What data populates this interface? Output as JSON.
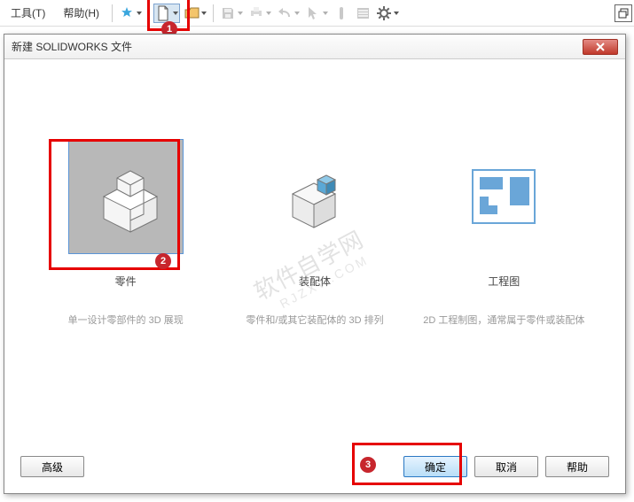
{
  "menu": {
    "tools": "工具(T)",
    "help": "帮助(H)"
  },
  "dialog": {
    "title": "新建 SOLIDWORKS 文件"
  },
  "options": [
    {
      "title": "零件",
      "desc": "单一设计零部件的 3D 展现"
    },
    {
      "title": "装配体",
      "desc": "零件和/或其它装配体的 3D 排列"
    },
    {
      "title": "工程图",
      "desc": "2D 工程制图，通常属于零件或装配体"
    }
  ],
  "buttons": {
    "advanced": "高级",
    "ok": "确定",
    "cancel": "取消",
    "help": "帮助"
  },
  "badges": {
    "b1": "1",
    "b2": "2",
    "b3": "3"
  },
  "watermark": {
    "line1": "软件自学网",
    "line2": "RJZXW.COM"
  }
}
